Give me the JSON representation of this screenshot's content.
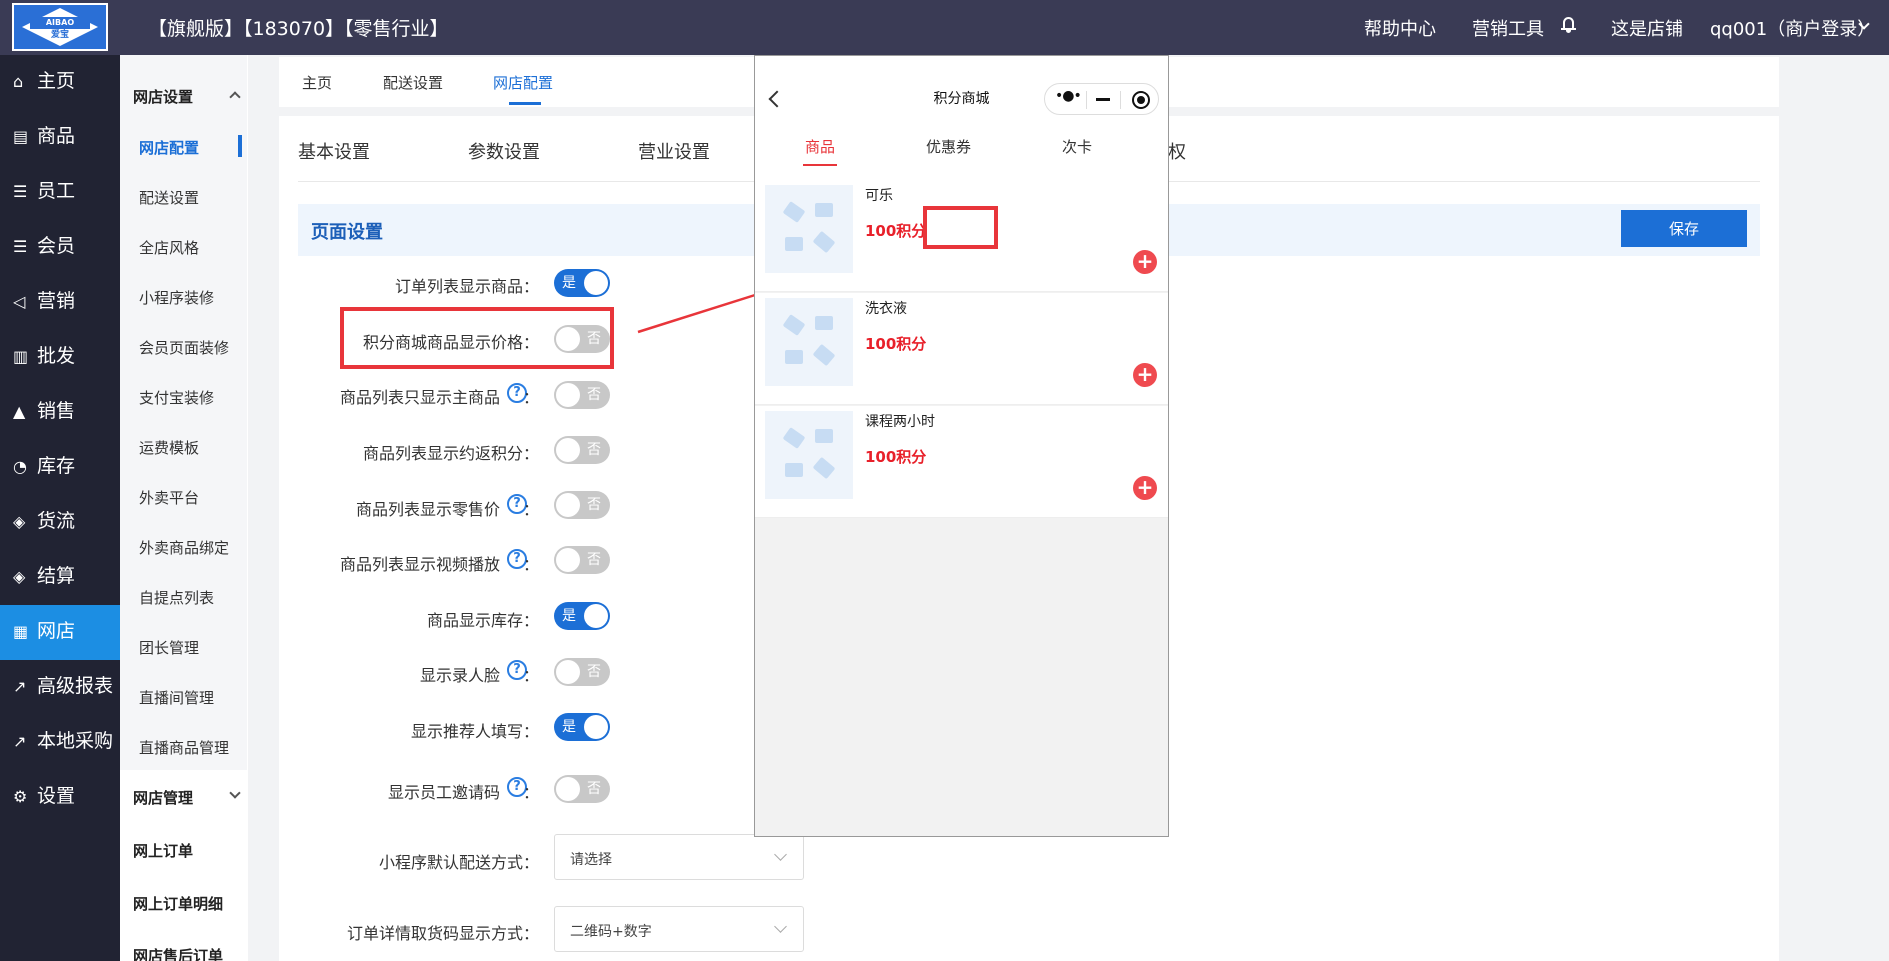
{
  "header": {
    "logo_text": "AIBAO",
    "logo_cn": "爱宝",
    "title": "【旗舰版】【183070】【零售行业】",
    "nav": [
      "帮助中心",
      "营销工具",
      "这是店铺",
      "qq001（商户登录）"
    ]
  },
  "sidebar": {
    "items": [
      {
        "icon": "⌂",
        "label": "主页"
      },
      {
        "icon": "▤",
        "label": "商品"
      },
      {
        "icon": "☰",
        "label": "员工"
      },
      {
        "icon": "☰",
        "label": "会员"
      },
      {
        "icon": "◁",
        "label": "营销"
      },
      {
        "icon": "▥",
        "label": "批发"
      },
      {
        "icon": "▲",
        "label": "销售"
      },
      {
        "icon": "◔",
        "label": "库存"
      },
      {
        "icon": "◈",
        "label": "货流"
      },
      {
        "icon": "◈",
        "label": "结算"
      },
      {
        "icon": "▦",
        "label": "网店"
      },
      {
        "icon": "↗",
        "label": "高级报表"
      },
      {
        "icon": "↗",
        "label": "本地采购"
      },
      {
        "icon": "⚙",
        "label": "设置"
      }
    ]
  },
  "subnav": {
    "group1": "网店设置",
    "items": [
      "网店配置",
      "配送设置",
      "全店风格",
      "小程序装修",
      "会员页面装修",
      "支付宝装修",
      "运费模板",
      "外卖平台",
      "外卖商品绑定",
      "自提点列表",
      "团长管理",
      "直播间管理",
      "直播商品管理"
    ],
    "group2": "网店管理",
    "items2": [
      "网上订单",
      "网上订单明细",
      "网店售后订单"
    ]
  },
  "top_tabs": [
    "主页",
    "配送设置",
    "网店配置"
  ],
  "content_tabs": [
    "基本设置",
    "参数设置",
    "营业设置",
    "权"
  ],
  "section": {
    "title": "页面设置",
    "save": "保存"
  },
  "settings": [
    {
      "label": "订单列表显示商品：",
      "state": "是"
    },
    {
      "label": "积分商城商品显示价格：",
      "state": "否"
    },
    {
      "label": "商品列表只显示主商品",
      "help": "?",
      "colon": "：",
      "state": "否"
    },
    {
      "label": "商品列表显示约返积分：",
      "state": "否"
    },
    {
      "label": "商品列表显示零售价",
      "help": "?",
      "colon": "：",
      "state": "否"
    },
    {
      "label": "商品列表显示视频播放",
      "help": "?",
      "colon": "：",
      "state": "否"
    },
    {
      "label": "商品显示库存：",
      "state": "是"
    },
    {
      "label": "显示录人脸",
      "help": "?",
      "colon": "：",
      "state": "否"
    },
    {
      "label": "显示推荐人填写：",
      "state": "是"
    },
    {
      "label": "显示员工邀请码",
      "help": "?",
      "colon": "：",
      "state": "否"
    }
  ],
  "selects": [
    {
      "label": "小程序默认配送方式：",
      "value": "请选择"
    },
    {
      "label": "订单详情取货码显示方式：",
      "value": "二维码+数字"
    }
  ],
  "phone": {
    "title": "积分商城",
    "capsule": "•●•",
    "tabs": [
      "商品",
      "优惠券",
      "次卡"
    ],
    "products": [
      {
        "name": "可乐",
        "price": "100积分"
      },
      {
        "name": "洗衣液",
        "price": "100积分"
      },
      {
        "name": "课程两小时",
        "price": "100积分"
      }
    ],
    "plus": "+"
  },
  "colors": {
    "primary": "#1c6fd6",
    "topbar": "#3a3b55",
    "sidebar": "#212333",
    "active": "#1c8ee3",
    "annotation": "#e8353a",
    "price": "#e8202a"
  }
}
